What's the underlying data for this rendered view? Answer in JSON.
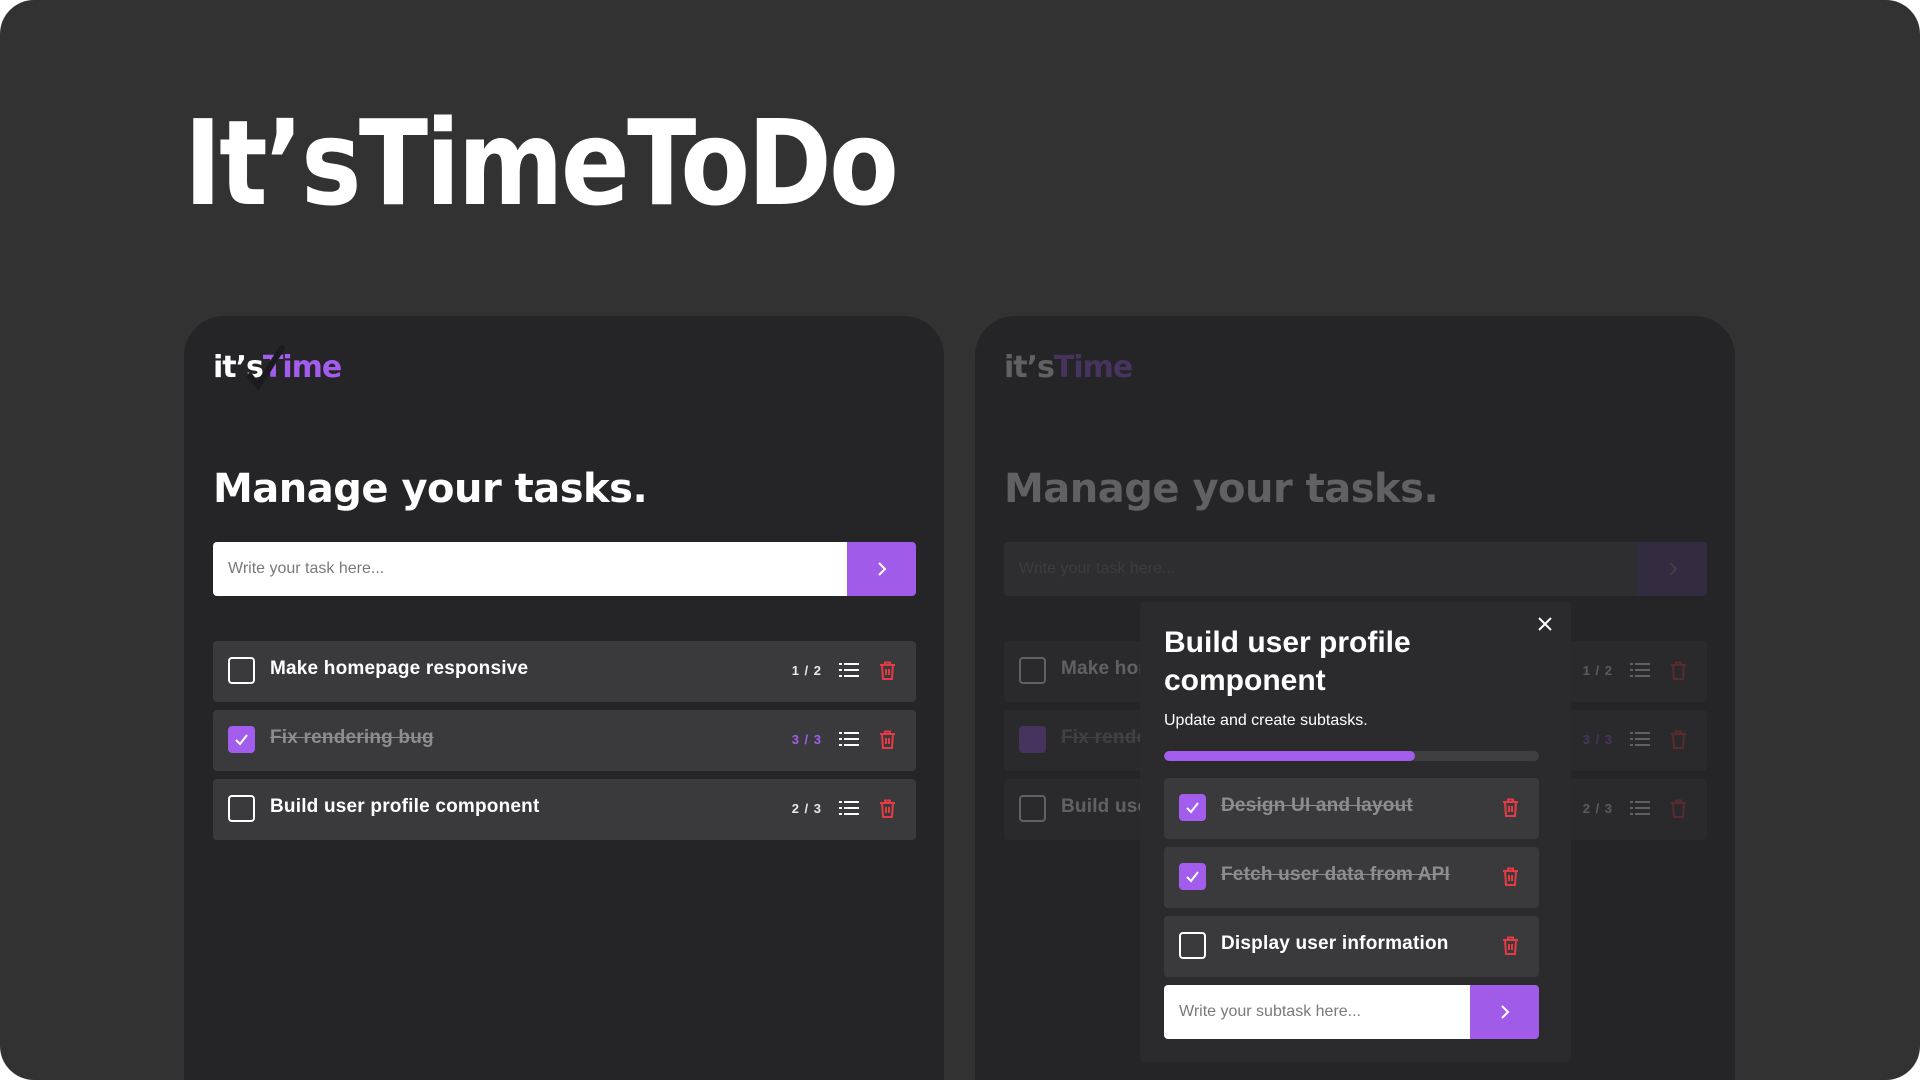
{
  "hero": {
    "title": "It’sTimeToDo"
  },
  "app": {
    "logo_a": "it’s",
    "logo_b": "Time",
    "heading": "Manage your tasks.",
    "input_placeholder": "Write your task here...",
    "tasks": [
      {
        "label": "Make homepage responsive",
        "count": "1 / 2",
        "done": false
      },
      {
        "label": "Fix rendering bug",
        "count": "3 / 3",
        "done": true
      },
      {
        "label": "Build user profile component",
        "count": "2 / 3",
        "done": false
      }
    ]
  },
  "modal": {
    "title": "Build user profile component",
    "subtitle": "Update and create subtasks.",
    "progress": 0.67,
    "subtasks": [
      {
        "label": "Design UI and layout",
        "done": true
      },
      {
        "label": "Fetch user data from API",
        "done": true
      },
      {
        "label": "Display user information",
        "done": false
      }
    ],
    "input_placeholder": "Write your subtask here..."
  },
  "colors": {
    "accent": "#a25ded",
    "danger": "#e53b45",
    "panel": "#252528",
    "background": "#323233"
  }
}
